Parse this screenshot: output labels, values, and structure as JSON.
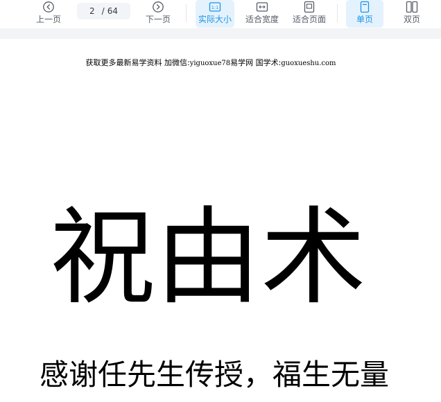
{
  "toolbar": {
    "prev_label": "上一页",
    "next_label": "下一页",
    "page": {
      "current": "2",
      "separator": "/",
      "total": "64"
    },
    "actual_size_label": "实际大小",
    "fit_width_label": "适合宽度",
    "fit_page_label": "适合页面",
    "single_page_label": "单页",
    "double_page_label": "双页",
    "actual_size_icon_text": "1:1",
    "accent_color": "#1a93e8",
    "active_bg_color": "#e4f2fd"
  },
  "document": {
    "header": {
      "prefix": "获取更多最新易学资料 加微信:",
      "wechat": "yiguoxue78",
      "site_label": "易学网 国学术:",
      "site_url": "guoxueshu.com"
    },
    "title": "祝由术",
    "subtitle": "感谢任先生传授，福生无量"
  }
}
